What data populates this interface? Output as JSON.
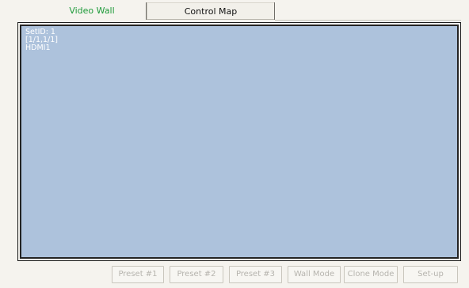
{
  "tabs": [
    {
      "label": "Video Wall",
      "active": true,
      "color": "#1e9a3a"
    },
    {
      "label": "Control Map",
      "active": false
    }
  ],
  "wall": {
    "background_color": "#adc2dc",
    "cells": [
      {
        "set_id": "SetID: 1",
        "position": "[1/1,1/1]",
        "input": "HDMI1"
      }
    ]
  },
  "buttons": [
    {
      "label": "Preset #1",
      "enabled": false
    },
    {
      "label": "Preset #2",
      "enabled": false
    },
    {
      "label": "Preset #3",
      "enabled": false
    },
    {
      "label": "Wall Mode",
      "enabled": false
    },
    {
      "label": "Clone Mode",
      "enabled": false
    },
    {
      "label": "Set-up",
      "enabled": false
    }
  ]
}
